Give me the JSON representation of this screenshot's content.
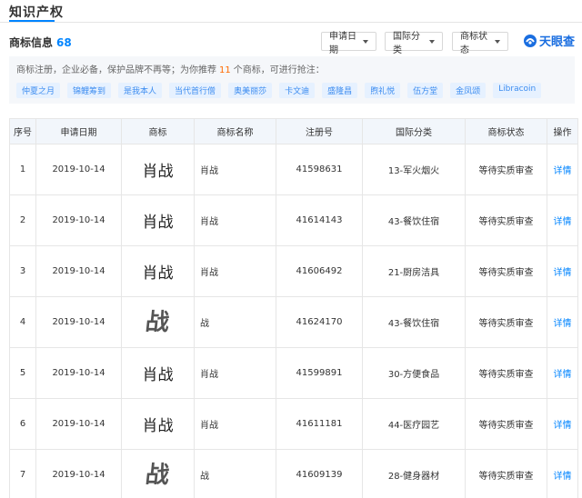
{
  "page": {
    "title": "知识产权"
  },
  "header": {
    "label": "商标信息",
    "count": "68",
    "filters": [
      {
        "label": "申请日期"
      },
      {
        "label": "国际分类"
      },
      {
        "label": "商标状态"
      }
    ],
    "brand": "天眼查"
  },
  "promo": {
    "text_before": "商标注册，企业必备，保护品牌不再等；为你推荐",
    "count": "11",
    "text_after": "个商标，可进行抢注：",
    "chips": [
      "仲夏之月",
      "锦鲤筹到",
      "是我本人",
      "当代首行僧",
      "奥美丽莎",
      "卡文迪",
      "盛隆昌",
      "煦礼悦",
      "伍方堂",
      "金凤颂",
      "Libracoin"
    ]
  },
  "table": {
    "headers": [
      "序号",
      "申请日期",
      "商标",
      "商标名称",
      "注册号",
      "国际分类",
      "商标状态",
      "操作"
    ],
    "rows": [
      {
        "index": "1",
        "date": "2019-10-14",
        "mark": "肖战",
        "mark_style": "text",
        "name": "肖战",
        "reg_no": "41598631",
        "class": "13-军火烟火",
        "status": "等待实质审查",
        "action": "详情"
      },
      {
        "index": "2",
        "date": "2019-10-14",
        "mark": "肖战",
        "mark_style": "text",
        "name": "肖战",
        "reg_no": "41614143",
        "class": "43-餐饮住宿",
        "status": "等待实质审查",
        "action": "详情"
      },
      {
        "index": "3",
        "date": "2019-10-14",
        "mark": "肖战",
        "mark_style": "text",
        "name": "肖战",
        "reg_no": "41606492",
        "class": "21-厨房洁具",
        "status": "等待实质审查",
        "action": "详情"
      },
      {
        "index": "4",
        "date": "2019-10-14",
        "mark": "战",
        "mark_style": "art",
        "name": "战",
        "reg_no": "41624170",
        "class": "43-餐饮住宿",
        "status": "等待实质审查",
        "action": "详情"
      },
      {
        "index": "5",
        "date": "2019-10-14",
        "mark": "肖战",
        "mark_style": "text",
        "name": "肖战",
        "reg_no": "41599891",
        "class": "30-方便食品",
        "status": "等待实质审查",
        "action": "详情"
      },
      {
        "index": "6",
        "date": "2019-10-14",
        "mark": "肖战",
        "mark_style": "text",
        "name": "肖战",
        "reg_no": "41611181",
        "class": "44-医疗园艺",
        "status": "等待实质审查",
        "action": "详情"
      },
      {
        "index": "7",
        "date": "2019-10-14",
        "mark": "战",
        "mark_style": "art",
        "name": "战",
        "reg_no": "41609139",
        "class": "28-健身器材",
        "status": "等待实质审查",
        "action": "详情"
      }
    ]
  }
}
